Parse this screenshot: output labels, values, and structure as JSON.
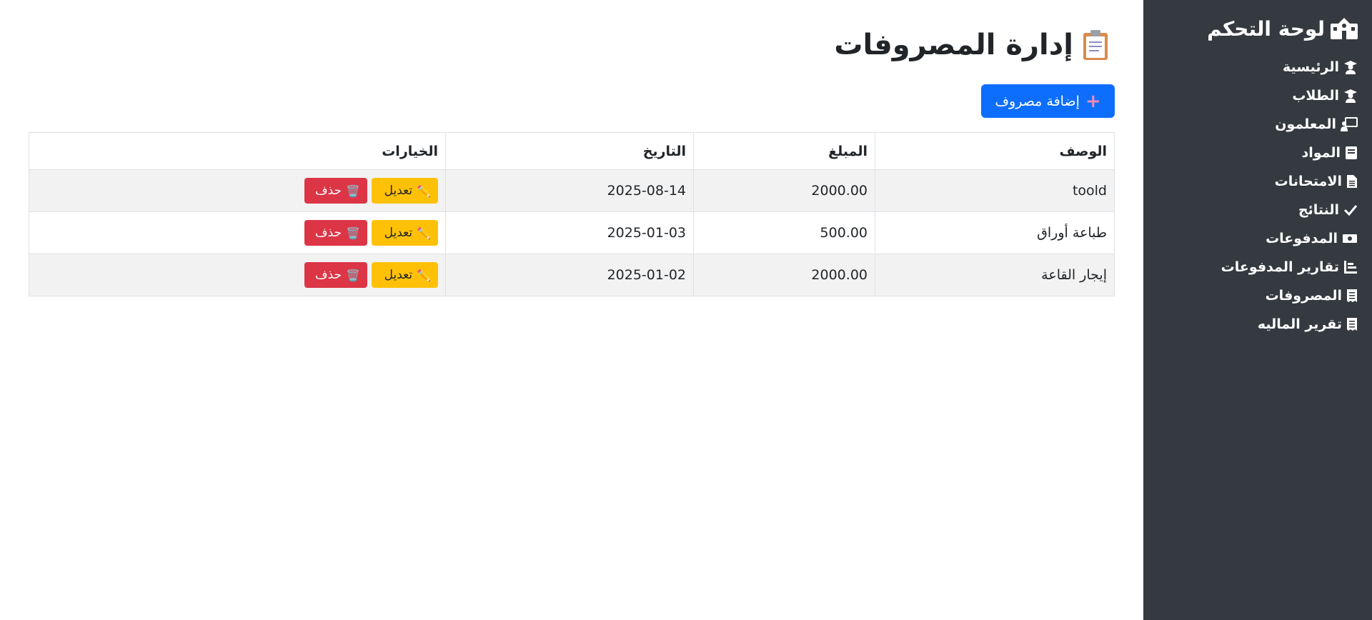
{
  "sidebar": {
    "brand": "لوحة التحكم",
    "brand_icon": "school-building-icon",
    "items": [
      {
        "label": "الرئيسية",
        "icon": "graduate-icon"
      },
      {
        "label": "الطلاب",
        "icon": "graduate-icon"
      },
      {
        "label": "المعلمون",
        "icon": "teacher-board-icon"
      },
      {
        "label": "المواد",
        "icon": "book-icon"
      },
      {
        "label": "الامتحانات",
        "icon": "file-icon"
      },
      {
        "label": "النتائج",
        "icon": "check-icon"
      },
      {
        "label": "المدفوعات",
        "icon": "money-icon"
      },
      {
        "label": "تقارير المدفوعات",
        "icon": "report-icon"
      },
      {
        "label": "المصروفات",
        "icon": "receipt-icon"
      },
      {
        "label": "تقرير الماليه",
        "icon": "receipt-icon"
      }
    ]
  },
  "page": {
    "title": "إدارة المصروفات",
    "title_icon": "clipboard-icon",
    "add_button": "إضافة مصروف",
    "add_icon": "plus-icon"
  },
  "table": {
    "headers": {
      "description": "الوصف",
      "amount": "المبلغ",
      "date": "التاريخ",
      "options": "الخيارات"
    },
    "rows": [
      {
        "description": "toold",
        "amount": "2000.00",
        "date": "2025-08-14"
      },
      {
        "description": "طباعة أوراق",
        "amount": "500.00",
        "date": "2025-01-03"
      },
      {
        "description": "إيجار القاعة",
        "amount": "2000.00",
        "date": "2025-01-02"
      }
    ],
    "edit_label": "تعديل",
    "delete_label": "حذف",
    "edit_icon": "pencil-icon",
    "delete_icon": "trash-icon"
  },
  "colors": {
    "sidebar_bg": "#343a40",
    "primary": "#0d6efd",
    "warning": "#ffc107",
    "danger": "#dc3545"
  }
}
